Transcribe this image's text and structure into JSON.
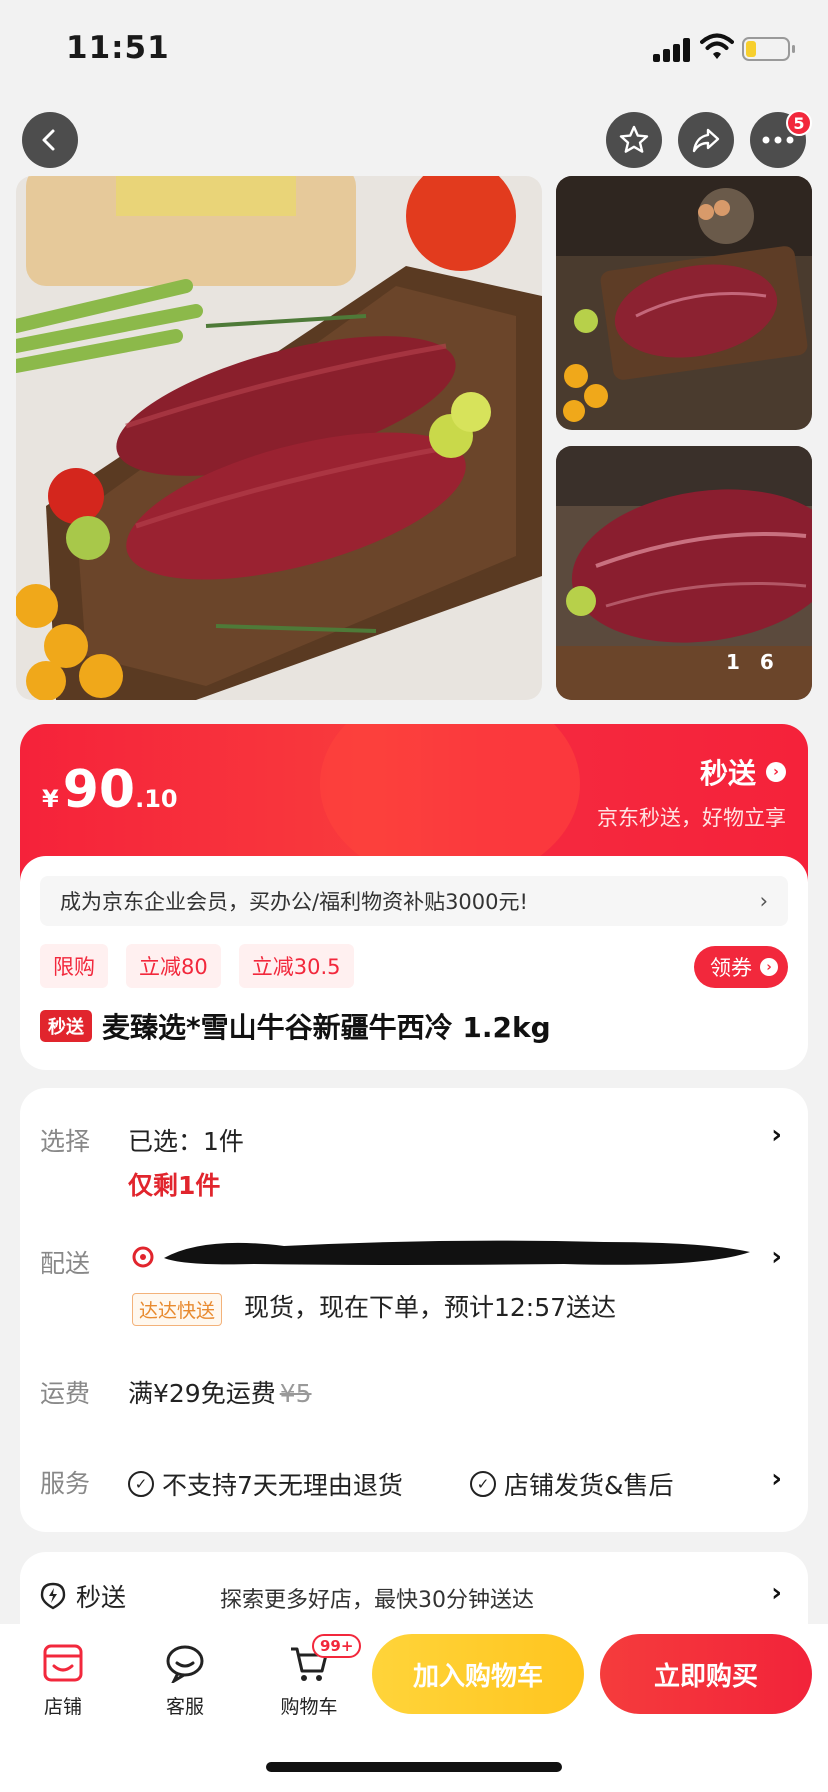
{
  "status": {
    "time": "11:51"
  },
  "nav": {
    "notif_count": "5"
  },
  "gallery": {
    "current": "1",
    "total": "6"
  },
  "price": {
    "currency": "¥",
    "integer": "90",
    "decimal": ".10",
    "service_title": "秒送",
    "service_sub": "京东秒送，好物立享"
  },
  "promo": {
    "banner": "成为京东企业会员，买办公/福利物资补贴3000元!",
    "tags": [
      "限购",
      "立减80",
      "立减30.5"
    ],
    "coupon_label": "领券"
  },
  "product": {
    "badge": "秒送",
    "title": "麦臻选*雪山牛谷新疆牛西冷 1.2kg"
  },
  "details": {
    "select_label": "选择",
    "select_value": "已选：1件",
    "stock": "仅剩1件",
    "delivery_label": "配送",
    "delivery_tag": "达达快送",
    "delivery_text": "现货，现在下单，预计12:57送达",
    "shipping_label": "运费",
    "shipping_value": "满¥29免运费",
    "shipping_original": "¥5",
    "service_label": "服务",
    "service_1": "不支持7天无理由退货",
    "service_2": "店铺发货&售后"
  },
  "miaosong": {
    "label": "秒送",
    "desc": "探索更多好店，最快30分钟送达"
  },
  "bottom": {
    "shop": "店铺",
    "service": "客服",
    "cart": "购物车",
    "cart_count": "99+",
    "add_cart": "加入购物车",
    "buy_now": "立即购买"
  },
  "colors": {
    "accent": "#f2283c",
    "cart_button": "#ffc51f"
  }
}
